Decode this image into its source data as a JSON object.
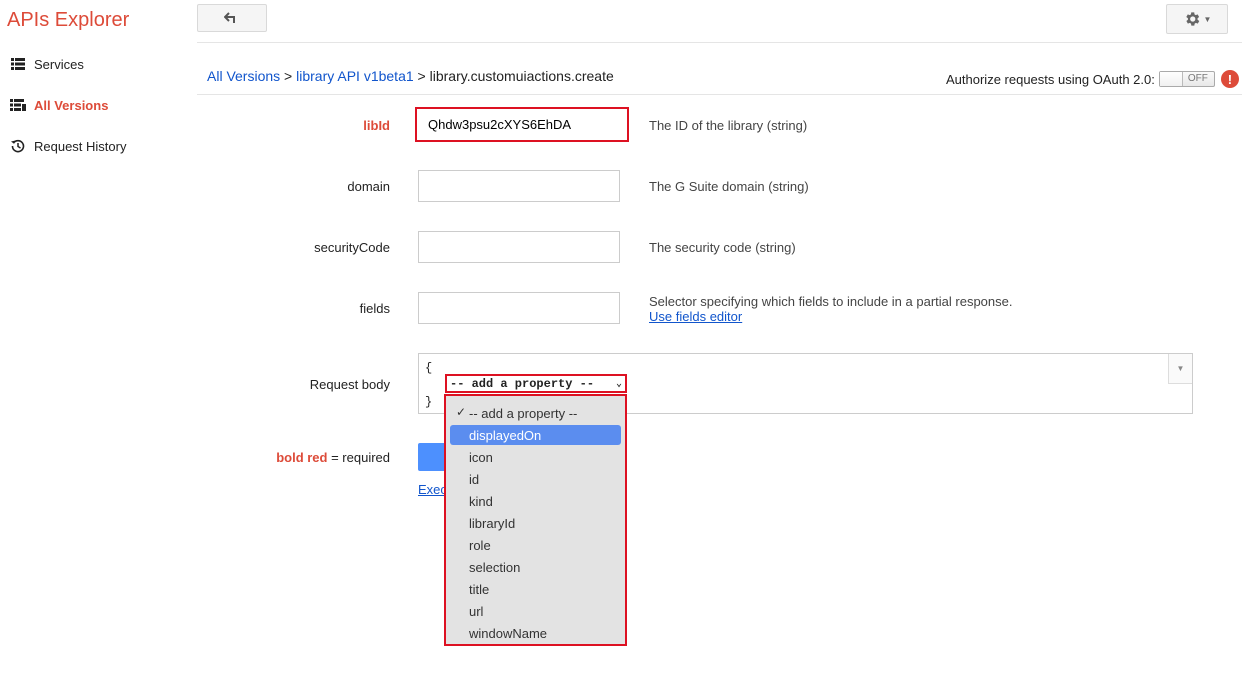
{
  "app": {
    "title": "APIs Explorer"
  },
  "sidebar": {
    "items": [
      {
        "label": "Services",
        "icon": "list-icon",
        "active": false
      },
      {
        "label": "All Versions",
        "icon": "versions-list-icon",
        "active": true
      },
      {
        "label": "Request History",
        "icon": "history-icon",
        "active": false
      }
    ]
  },
  "breadcrumb": {
    "link1": "All Versions",
    "sep1": " > ",
    "link2": "library API v1beta1",
    "sep2": " > ",
    "current": "library.customuiactions.create"
  },
  "oauth": {
    "label": "Authorize requests using OAuth 2.0:",
    "toggle_state": "OFF",
    "warning": "!"
  },
  "form": {
    "fields": [
      {
        "label": "libId",
        "value": "Qhdw3psu2cXYS6EhDA",
        "required": true,
        "description": "The ID of the library (string)"
      },
      {
        "label": "domain",
        "value": "",
        "required": false,
        "description": "The G Suite domain (string)"
      },
      {
        "label": "securityCode",
        "value": "",
        "required": false,
        "description": "The security code (string)"
      },
      {
        "label": "fields",
        "value": "",
        "required": false,
        "description": "Selector specifying which fields to include in a partial response.",
        "link": "Use fields editor"
      }
    ],
    "request_body": {
      "label": "Request body",
      "open_brace": "{",
      "close_brace": "}",
      "select_value": "-- add a property --",
      "options": [
        "-- add a property --",
        "displayedOn",
        "icon",
        "id",
        "kind",
        "libraryId",
        "role",
        "selection",
        "title",
        "url",
        "windowName"
      ],
      "checked_option": "-- add a property --",
      "highlighted_option": "displayedOn"
    },
    "legend": {
      "bold": "bold red",
      "rest": " = required"
    },
    "execute_link": "Exec"
  },
  "colors": {
    "brand": "#dd4b39",
    "link": "#1155cc",
    "highlight_border": "#dd1122",
    "selected_option": "#5b8def"
  }
}
